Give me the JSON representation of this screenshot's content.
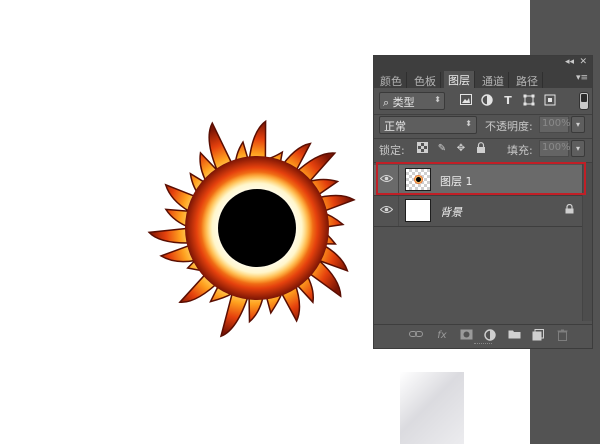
{
  "panel": {
    "collapse_icon": "◂◂",
    "close_icon": "✕",
    "menu_icon": "▾≡",
    "tabs": [
      {
        "label": "颜色",
        "active": false
      },
      {
        "label": "色板",
        "active": false
      },
      {
        "label": "图层",
        "active": true
      },
      {
        "label": "通道",
        "active": false
      },
      {
        "label": "路径",
        "active": false
      }
    ],
    "filter": {
      "search_glyph": "⌕",
      "kind_label": "类型",
      "icons": [
        "image-filter-icon",
        "adjustment-filter-icon",
        "type-filter-icon",
        "shape-filter-icon",
        "smart-object-filter-icon"
      ]
    },
    "blend_mode": "正常",
    "opacity_label": "不透明度:",
    "opacity_value": "100%",
    "lock_label": "锁定:",
    "fill_label": "填充:",
    "fill_value": "100%",
    "layers": [
      {
        "name": "图层 1",
        "selected": true,
        "visible": true,
        "locked": false,
        "thumb": "transparent-with-flame"
      },
      {
        "name": "背景",
        "selected": false,
        "visible": true,
        "locked": true,
        "thumb": "white"
      }
    ],
    "footer_icons": [
      "link-icon",
      "fx-icon",
      "mask-icon",
      "adjustment-icon",
      "folder-icon",
      "new-layer-icon",
      "trash-icon"
    ],
    "fx_label": "fx"
  },
  "colors": {
    "panel_bg": "#535353",
    "selected_layer": "#6a6a6a",
    "highlight_border": "#c11f26",
    "canvas_bg": "#ffffff"
  }
}
